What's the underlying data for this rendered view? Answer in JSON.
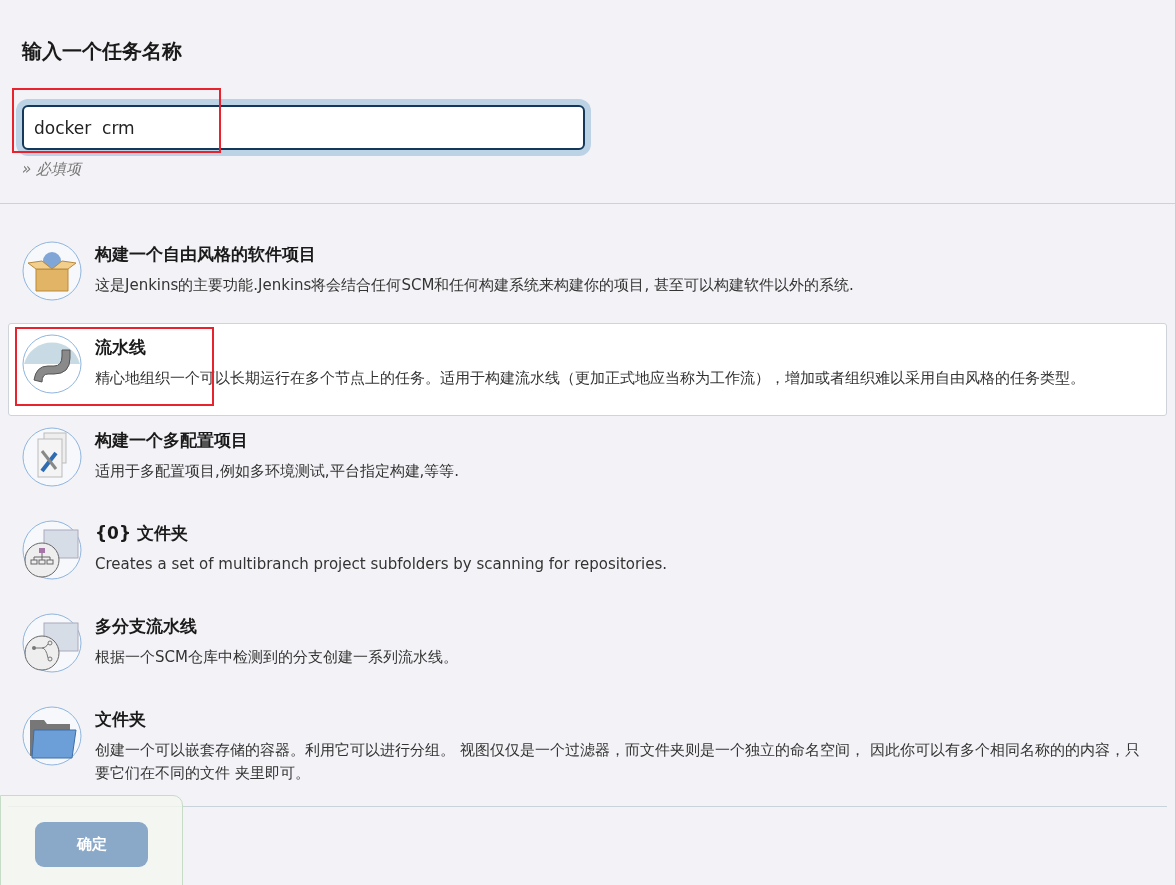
{
  "name_field": {
    "label": "输入一个任务名称",
    "value": "docker  crm",
    "hint": "» 必填项"
  },
  "items": [
    {
      "kind": "freestyle",
      "title": "构建一个自由风格的软件项目",
      "description": "这是Jenkins的主要功能.Jenkins将会结合任何SCM和任何构建系统来构建你的项目, 甚至可以构建软件以外的系统.",
      "selected": false
    },
    {
      "kind": "pipeline",
      "title": "流水线",
      "description": "精心地组织一个可以长期运行在多个节点上的任务。适用于构建流水线（更加正式地应当称为工作流），增加或者组织难以采用自由风格的任务类型。",
      "selected": true
    },
    {
      "kind": "matrix",
      "title": "构建一个多配置项目",
      "description": "适用于多配置项目,例如多环境测试,平台指定构建,等等.",
      "selected": false
    },
    {
      "kind": "org_folder",
      "title": "{0} 文件夹",
      "description": "Creates a set of multibranch project subfolders by scanning for repositories.",
      "selected": false
    },
    {
      "kind": "multibranch",
      "title": "多分支流水线",
      "description": "根据一个SCM仓库中检测到的分支创建一系列流水线。",
      "selected": false
    },
    {
      "kind": "folder",
      "title": "文件夹",
      "description": "创建一个可以嵌套存储的容器。利用它可以进行分组。 视图仅仅是一个过滤器，而文件夹则是一个独立的命名空间， 因此你可以有多个相同名称的的内容，只要它们在不同的文件 夹里即可。",
      "selected": false
    }
  ],
  "ok_button": {
    "label": "确定"
  }
}
